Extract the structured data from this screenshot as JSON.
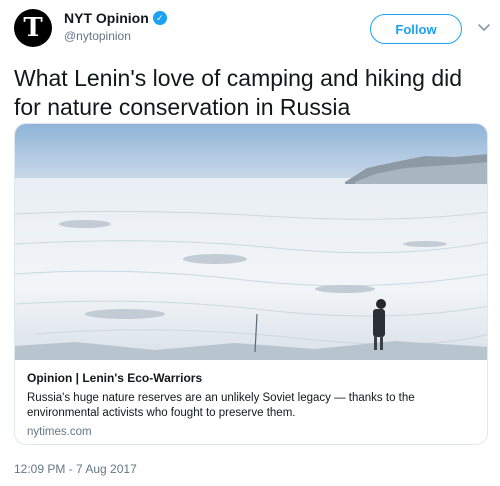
{
  "account": {
    "avatar_letter": "T",
    "display_name": "NYT Opinion",
    "handle": "@nytopinion",
    "verified": true
  },
  "header": {
    "follow_label": "Follow"
  },
  "icons": {
    "verified": "verified-badge-icon",
    "caret": "chevron-down-icon"
  },
  "tweet": {
    "text": "What Lenin's love of camping and hiking did for nature conservation in Russia"
  },
  "card": {
    "image_description": "frozen lake with a person standing on the ice",
    "title": "Opinion | Lenin's Eco-Warriors",
    "description": "Russia's huge nature reserves are an unlikely Soviet legacy — thanks to the environmental activists who fought to preserve them.",
    "domain": "nytimes.com"
  },
  "footer": {
    "timestamp": "12:09 PM - 7 Aug 2017"
  },
  "colors": {
    "accent": "#1da1f2",
    "text": "#14171a",
    "muted": "#657786",
    "border": "#e1e8ed"
  }
}
